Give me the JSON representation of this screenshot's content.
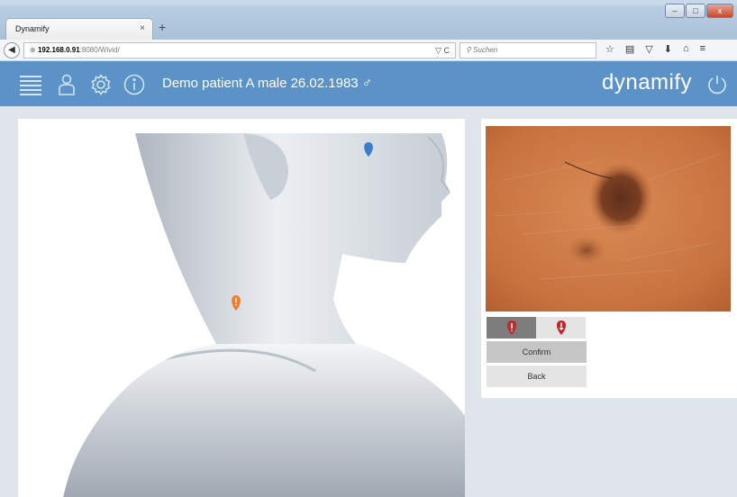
{
  "browser": {
    "tab_title": "Dynamify",
    "tab_close": "×",
    "new_tab": "+",
    "url_host": "192.168.0.91",
    "url_path": ":8080/Wivid/",
    "url_icons": "▽ C",
    "search_placeholder": "Suchen",
    "window_controls": {
      "minimize": "–",
      "maximize": "□",
      "close": "x"
    }
  },
  "header": {
    "patient_info": "Demo patient A male 26.02.1983 ♂",
    "brand": "dynamify"
  },
  "lesion_panel": {
    "confirm_label": "Confirm",
    "back_label": "Back"
  },
  "colors": {
    "header_bg": "#5b93c9",
    "marker_blue": "#3a7ec7",
    "marker_orange": "#ef7d2c",
    "marker_red": "#c1272d"
  },
  "icons": [
    "list-icon",
    "user-icon",
    "settings-icon",
    "info-icon",
    "power-icon"
  ]
}
